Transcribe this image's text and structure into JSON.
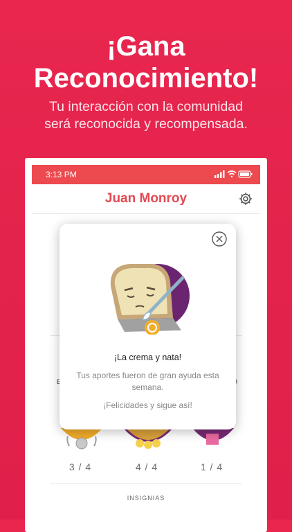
{
  "promo": {
    "title_line1": "¡Gana",
    "title_line2": "Reconocimiento!",
    "subtitle_line1": "Tu interacción con la comunidad",
    "subtitle_line2": "será reconocida y recompensada."
  },
  "status_bar": {
    "time": "3:13 PM"
  },
  "profile": {
    "name": "Juan Monroy",
    "badges": [
      {
        "count": "3 / 4"
      },
      {
        "count": "4 / 4"
      },
      {
        "count": "1 / 4"
      }
    ],
    "section_label": "INSIGNIAS",
    "partial_label_left": "E",
    "partial_label_right": "O"
  },
  "popup": {
    "title": "¡La crema y nata!",
    "body": "Tus aportes fueron de gran ayuda esta semana.",
    "cta": "¡Felicidades y sigue así!"
  },
  "colors": {
    "background": "#e8264e",
    "status_bar": "#ec4a4f",
    "name": "#e24954",
    "badge_purple": "#7a2a75",
    "badge_gold": "#f2ad2a"
  }
}
